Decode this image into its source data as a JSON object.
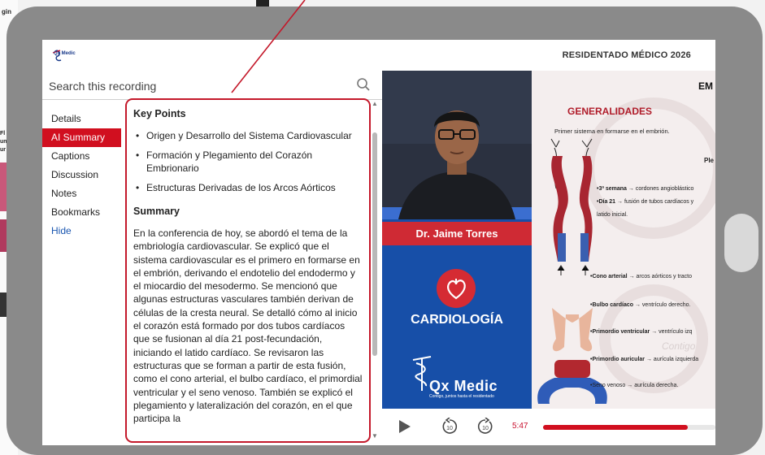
{
  "background_page": {
    "left_text_lines": [
      "gin",
      "...AT"
    ],
    "side_labels": [
      "Fl",
      "un",
      "ur"
    ]
  },
  "header": {
    "logo_text": "Qx Medic",
    "title": "RESIDENTADO MÉDICO 2026"
  },
  "search": {
    "placeholder": "Search this recording"
  },
  "tabs": [
    {
      "label": "Details"
    },
    {
      "label": "AI Summary"
    },
    {
      "label": "Captions"
    },
    {
      "label": "Discussion"
    },
    {
      "label": "Notes"
    },
    {
      "label": "Bookmarks"
    },
    {
      "label": "Hide"
    }
  ],
  "summary_panel": {
    "key_points_title": "Key Points",
    "key_points": [
      "Origen y Desarrollo del Sistema Cardiovascular",
      "Formación y Plegamiento del Corazón Embrionario",
      "Estructuras Derivadas de los Arcos Aórticos"
    ],
    "summary_title": "Summary",
    "summary_text": "En la conferencia de hoy, se abordó el tema de la embriología cardiovascular. Se explicó que el sistema cardiovascular es el primero en formarse en el embrión, derivando el endotelio del endodermo y el miocardio del mesodermo. Se mencionó que algunas estructuras vasculares también derivan de células de la cresta neural. Se detalló cómo al inicio el corazón está formado por dos tubos cardíacos que se fusionan al día 21 post-fecundación, iniciando el latido cardíaco. Se revisaron las estructuras que se forman a partir de esta fusión, como el cono arterial, el bulbo cardíaco, el primordial ventricular y el seno venoso. También se explicó el plegamiento y lateralización del corazón, en el que participa la"
  },
  "video": {
    "presenter_name": "Dr. Jaime Torres",
    "specialty": "CARDIOLOGÍA",
    "brand": "Qx Medic",
    "brand_tagline": "Contigo, juntos hasta el residentado"
  },
  "slide": {
    "corner_text": "EM",
    "heading": "GENERALIDADES",
    "intro": "Primer sistema en formarse en el embrión.",
    "side_label": "Ple",
    "notes": [
      {
        "bold": "•3ª semana",
        "text": " → cordones angioblástico"
      },
      {
        "bold": "•Día 21",
        "text": " → fusión de tubos cardíacos y"
      },
      {
        "bold": "",
        "text": "latido inicial."
      },
      {
        "bold": "•Cono arterial",
        "text": " → arcos aórticos y tracto"
      },
      {
        "bold": "•Bulbo cardíaco",
        "text": " → ventrículo derecho."
      },
      {
        "bold": "•Primordio ventricular",
        "text": " → ventrículo izq"
      },
      {
        "bold": "•Primordio auricular",
        "text": " → aurícula izquierda"
      },
      {
        "bold": "",
        "text": "•Seno venoso → aurícula derecha."
      }
    ],
    "watermark": "Contigo"
  },
  "player": {
    "current_time": "5:47",
    "rewind_seconds": "10",
    "forward_seconds": "10",
    "progress_fraction": 0.84
  },
  "colors": {
    "accent_red": "#d10f1f",
    "video_blue": "#174fa8",
    "tablet_frame": "#8a8a8a",
    "link_blue": "#1a56b0"
  }
}
